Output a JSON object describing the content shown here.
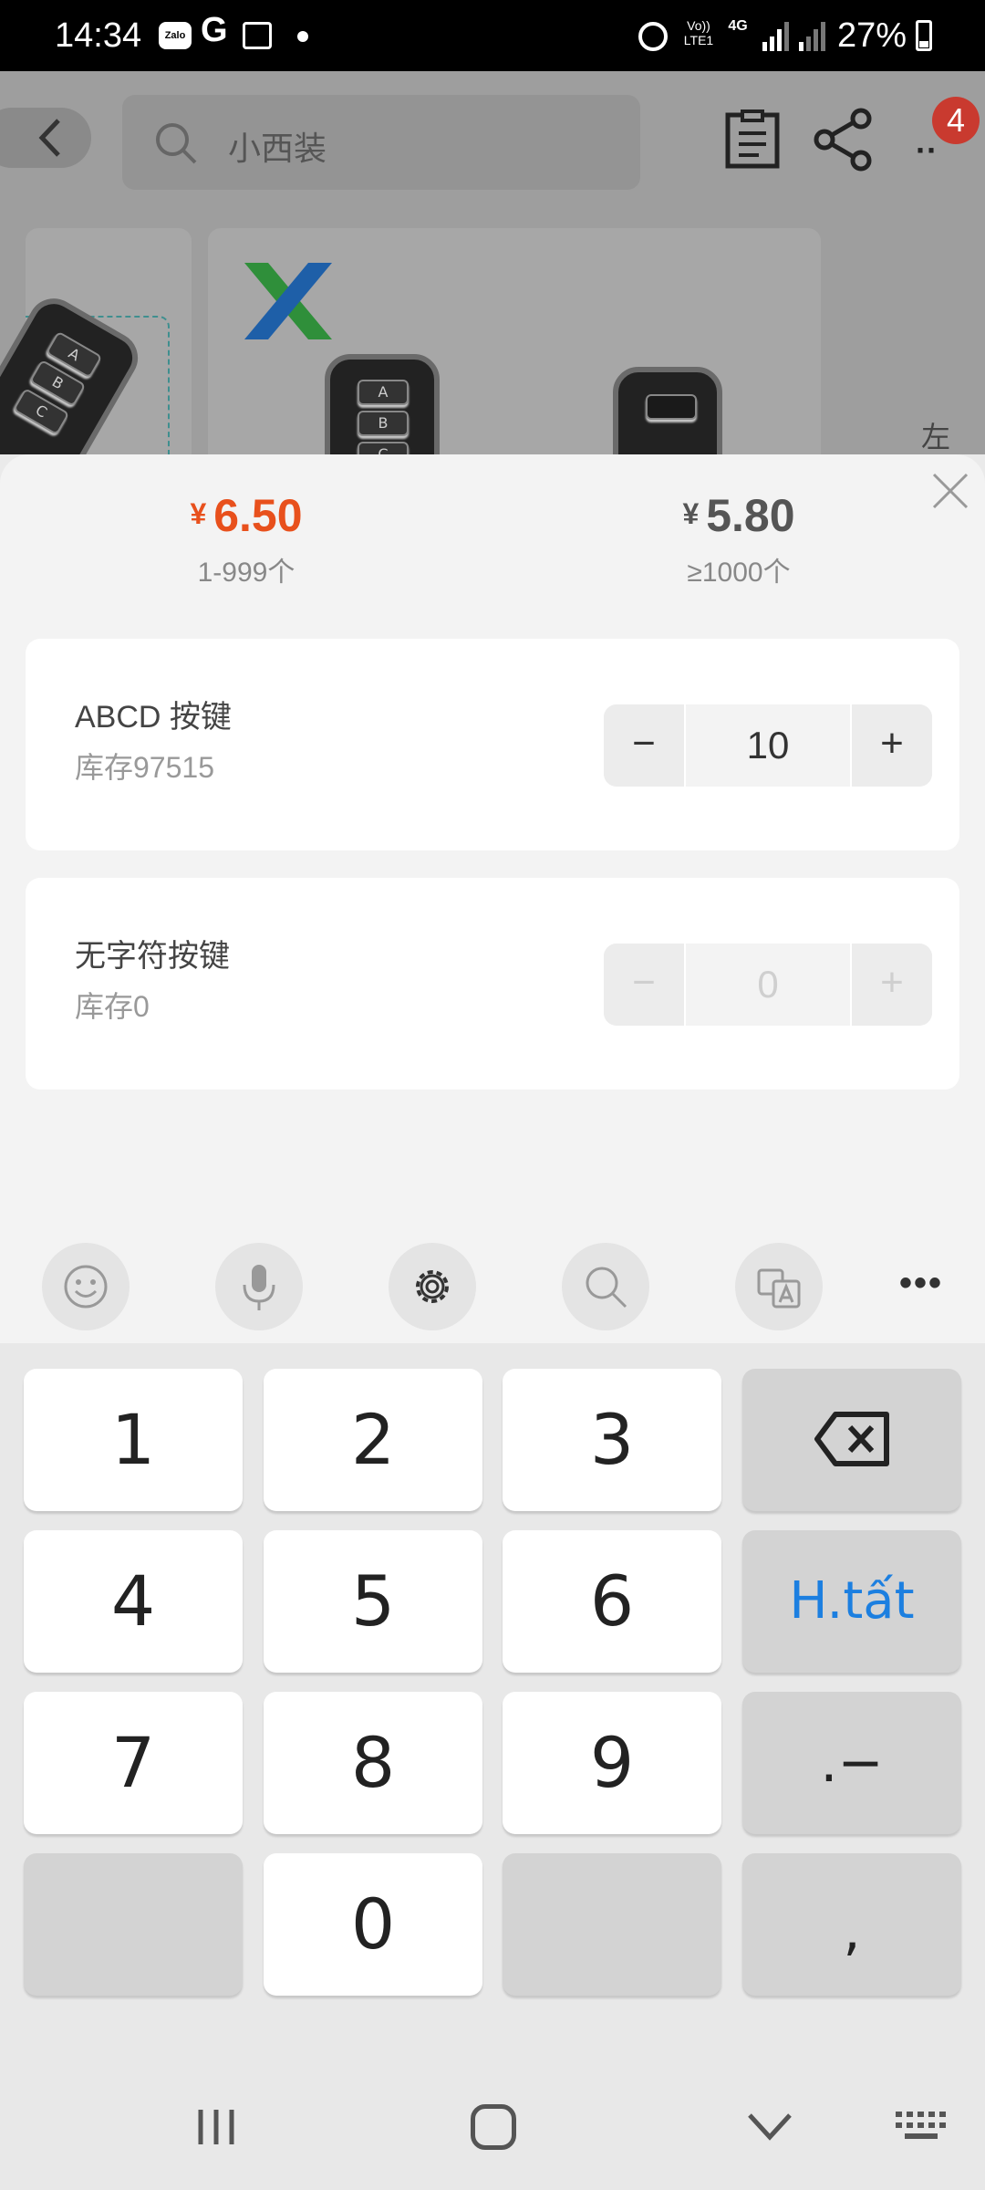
{
  "status_bar": {
    "time": "14:34",
    "zalo_label": "Zalo",
    "g_label": "G",
    "volte_label": "Vo)) LTE1",
    "network_label": "4G",
    "battery": "27%"
  },
  "header": {
    "search_placeholder": "小西装",
    "cart_badge": "4",
    "side_label": "左"
  },
  "remote_keys": [
    "A",
    "B",
    "C"
  ],
  "price_tiers": [
    {
      "currency": "¥",
      "price": "6.50",
      "range": "1-999个"
    },
    {
      "currency": "¥",
      "price": "5.80",
      "range": "≥1000个"
    }
  ],
  "variants": [
    {
      "name": "ABCD 按键",
      "stock": "库存97515",
      "quantity": "10",
      "minus": "−",
      "plus": "+"
    },
    {
      "name": "无字符按键",
      "stock": "库存0",
      "quantity": "0",
      "minus": "−",
      "plus": "+"
    }
  ],
  "keyboard": {
    "toolbar_icons": [
      "emoji-icon",
      "microphone-icon",
      "settings-icon",
      "search-icon",
      "translate-icon",
      "more-icon"
    ],
    "more_label": "•••",
    "keys": {
      "k1": "1",
      "k2": "2",
      "k3": "3",
      "k4": "4",
      "k5": "5",
      "k6": "6",
      "k7": "7",
      "k8": "8",
      "k9": "9",
      "k0": "0",
      "done": "H.tất",
      "dot_dash": ".−",
      "comma": ","
    },
    "done_color": "#1c7fe0"
  },
  "colors": {
    "accent_price": "#e8501c",
    "badge": "#c93a2f"
  }
}
